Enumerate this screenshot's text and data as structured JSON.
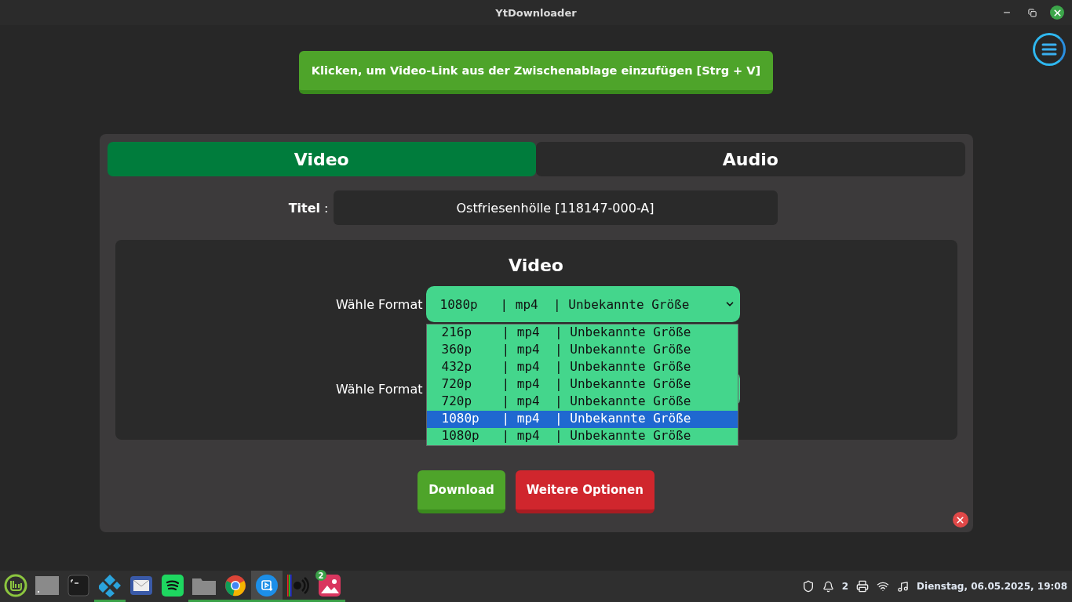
{
  "window": {
    "title": "YtDownloader"
  },
  "paste_button": {
    "label": "Klicken, um Video-Link aus der Zwischenablage einzufügen [Strg + V]"
  },
  "tabs": [
    {
      "label": "Video",
      "selected": true
    },
    {
      "label": "Audio",
      "selected": false
    }
  ],
  "title_field": {
    "label": "**Titel** :",
    "value": "Ostfriesenhölle [118147-000-A]"
  },
  "section": {
    "heading": "Video",
    "format_rows": [
      {
        "label": "Wähle Format",
        "value": "1080p   | mp4  | Unbekannte Größe"
      },
      {
        "label": "Wähle Format"
      }
    ]
  },
  "dropdown": {
    "options": [
      {
        "label": "216p    | mp4  | Unbekannte Größe",
        "selected": false
      },
      {
        "label": "360p    | mp4  | Unbekannte Größe",
        "selected": false
      },
      {
        "label": "432p    | mp4  | Unbekannte Größe",
        "selected": false
      },
      {
        "label": "720p    | mp4  | Unbekannte Größe",
        "selected": false
      },
      {
        "label": "720p    | mp4  | Unbekannte Größe",
        "selected": false
      },
      {
        "label": "1080p   | mp4  | Unbekannte Größe",
        "selected": true
      },
      {
        "label": "1080p   | mp4  | Unbekannte Größe",
        "selected": false
      }
    ]
  },
  "buttons": [
    {
      "label": "Download",
      "kind": "primary"
    },
    {
      "label": "Weitere Optionen",
      "kind": "danger"
    }
  ],
  "taskbar": {
    "apps": [
      {
        "kind": "menu",
        "running": false,
        "active": false
      },
      {
        "kind": "desktop",
        "running": false,
        "active": false
      },
      {
        "kind": "terminal",
        "running": false,
        "active": false
      },
      {
        "kind": "kodi",
        "running": true,
        "active": false
      },
      {
        "kind": "mail",
        "running": false,
        "active": false
      },
      {
        "kind": "spotify",
        "running": false,
        "active": false
      },
      {
        "kind": "files",
        "running": true,
        "active": false
      },
      {
        "kind": "chrome",
        "running": true,
        "active": false
      },
      {
        "kind": "downloader",
        "running": true,
        "active": true
      },
      {
        "kind": "audio",
        "running": true,
        "active": false
      },
      {
        "kind": "photos",
        "running": true,
        "active": false,
        "badge": "2"
      }
    ],
    "tray": {
      "notifications": "2",
      "clock": "Dienstag, 06.05.2025, 19:08"
    }
  }
}
